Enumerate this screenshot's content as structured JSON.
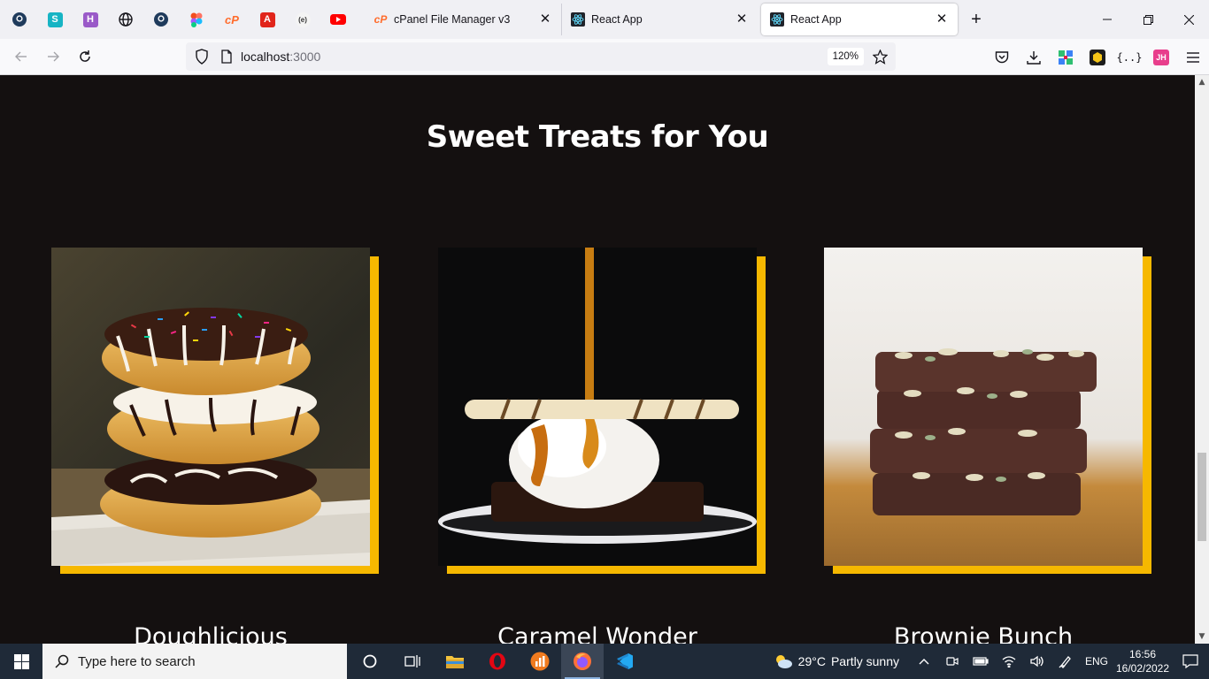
{
  "browser": {
    "pinned_tabs": [
      {
        "icon": "github-icon"
      },
      {
        "icon": "s-app-icon",
        "letter": "S"
      },
      {
        "icon": "h-app-icon",
        "letter": "H"
      },
      {
        "icon": "globe-icon"
      },
      {
        "icon": "github-icon"
      },
      {
        "icon": "figma-icon"
      },
      {
        "icon": "cpanel-icon",
        "letter": "cP"
      },
      {
        "icon": "adobe-icon",
        "letter": "A"
      },
      {
        "icon": "e-icon",
        "letter": "(e)"
      },
      {
        "icon": "youtube-icon"
      }
    ],
    "tabs": [
      {
        "title": "cPanel File Manager v3",
        "icon": "cpanel-icon",
        "icon_text": "cP"
      },
      {
        "title": "React App",
        "icon": "react-icon"
      },
      {
        "title": "React App",
        "icon": "react-icon",
        "active": true
      }
    ],
    "new_tab_label": "+",
    "url_host": "localhost",
    "url_port": ":3000",
    "zoom": "120%"
  },
  "page": {
    "heading": "Sweet Treats for You",
    "accent_color": "#f6b800",
    "background_color": "#141010",
    "cards": [
      {
        "title": "Doughlicious",
        "image": "stacked donuts"
      },
      {
        "title": "Caramel Wonder",
        "image": "ice cream with caramel"
      },
      {
        "title": "Brownie Bunch",
        "image": "stacked brownies"
      }
    ]
  },
  "taskbar": {
    "search_placeholder": "Type here to search",
    "temperature": "29°C",
    "weather": "Partly sunny",
    "language": "ENG",
    "time": "16:56",
    "date": "16/02/2022"
  }
}
